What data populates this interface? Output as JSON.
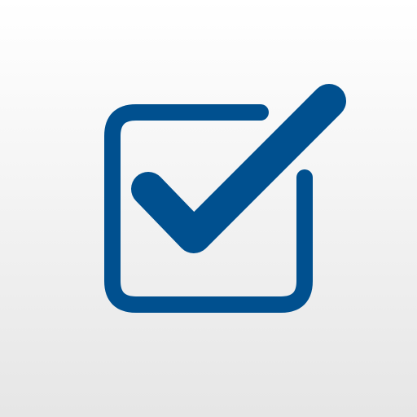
{
  "icon": {
    "name": "checkbox-checked-icon",
    "accent_color": "#00508f",
    "background_top": "#ffffff",
    "background_bottom": "#e6e6e6"
  }
}
